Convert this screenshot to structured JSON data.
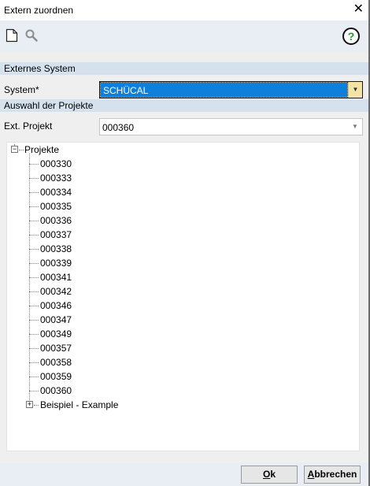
{
  "window": {
    "title": "Extern zuordnen",
    "close_glyph": "✕"
  },
  "toolbar": {
    "new_icon": "new-document-icon",
    "search_icon": "search-icon",
    "help_icon": "help-icon",
    "help_glyph": "?"
  },
  "sections": {
    "external": "Externes System",
    "projects": "Auswahl der Projekte"
  },
  "fields": {
    "system": {
      "label": "System*",
      "value": "SCHÜCAL"
    },
    "ext_project": {
      "label": "Ext. Projekt",
      "value": "000360"
    }
  },
  "tree": {
    "root": {
      "label": "Projekte",
      "expander": "−"
    },
    "items": [
      "000330",
      "000333",
      "000334",
      "000335",
      "000336",
      "000337",
      "000338",
      "000339",
      "000341",
      "000342",
      "000346",
      "000347",
      "000349",
      "000357",
      "000358",
      "000359",
      "000360"
    ],
    "second": {
      "label": "Beispiel - Example",
      "expander": "+"
    }
  },
  "buttons": {
    "ok": {
      "mnemonic": "O",
      "rest": "k"
    },
    "cancel": {
      "mnemonic": "A",
      "rest": "bbrechen"
    }
  }
}
